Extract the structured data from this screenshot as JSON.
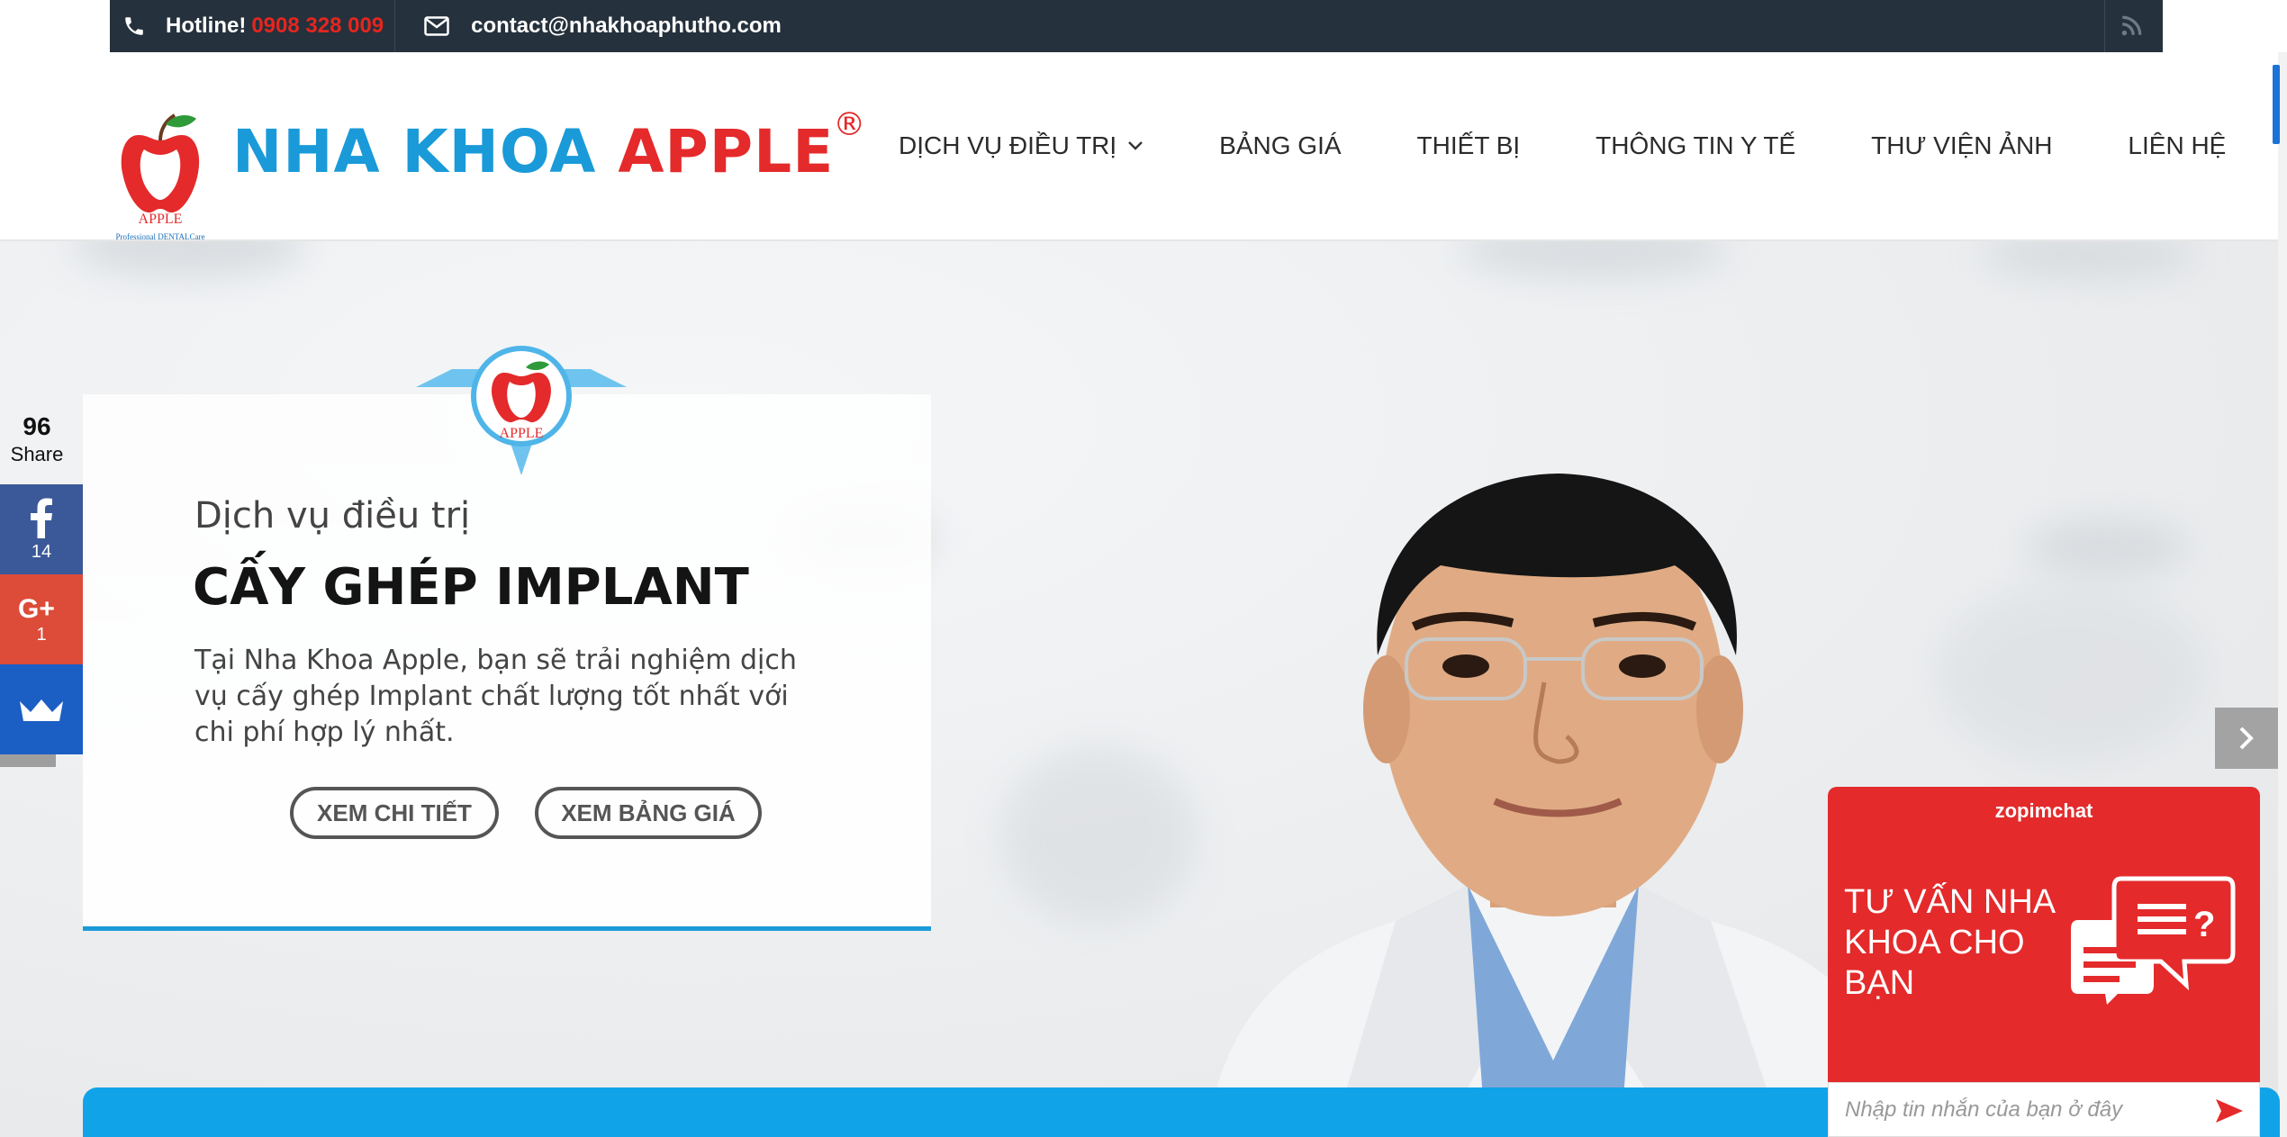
{
  "topbar": {
    "hotline_label": "Hotline!",
    "hotline_number": "0908 328 009",
    "email": "contact@nhakhoaphutho.com"
  },
  "header": {
    "logo_caption_top": "APPLE",
    "logo_caption_bottom": "Professional DENTALCare",
    "brand_blue": "NHA KHOA",
    "brand_red": "APPLE",
    "brand_reg": "®",
    "nav": [
      {
        "label": "DỊCH VỤ ĐIỀU TRỊ"
      },
      {
        "label": "BẢNG GIÁ"
      },
      {
        "label": "THIẾT BỊ"
      },
      {
        "label": "THÔNG TIN Y TẾ"
      },
      {
        "label": "THƯ VIỆN ẢNH"
      },
      {
        "label": "LIÊN HỆ"
      }
    ]
  },
  "hero": {
    "badge_text": "APPLE",
    "subtitle": "Dịch vụ điều trị",
    "title": "CẤY GHÉP IMPLANT",
    "description": "Tại Nha Khoa Apple, bạn sẽ trải nghiệm dịch vụ cấy ghép Implant chất lượng tốt nhất với chi phí hợp lý nhất.",
    "btn_detail": "XEM CHI TIẾT",
    "btn_price": "XEM BẢNG GIÁ"
  },
  "share": {
    "total": "96",
    "label": "Share",
    "facebook_count": "14",
    "googleplus_count": "1"
  },
  "chat": {
    "brand": "zopimchat",
    "title": "TƯ VẤN NHA KHOA CHO BẠN",
    "input_placeholder": "Nhập tin nhắn của bạn ở đây"
  },
  "colors": {
    "topbar_bg": "#25313c",
    "brand_blue": "#1a9ad8",
    "brand_red": "#e42a2b",
    "accent_blue": "#11a3e8",
    "facebook": "#3b5998",
    "googleplus": "#dd4b39",
    "chat_red": "#e42a2b"
  },
  "icons": [
    "phone-icon",
    "mail-icon",
    "rss-icon",
    "chevron-down-icon",
    "facebook-icon",
    "google-plus-icon",
    "crown-icon",
    "chevron-right-icon",
    "chat-bubble-icon",
    "send-icon"
  ]
}
